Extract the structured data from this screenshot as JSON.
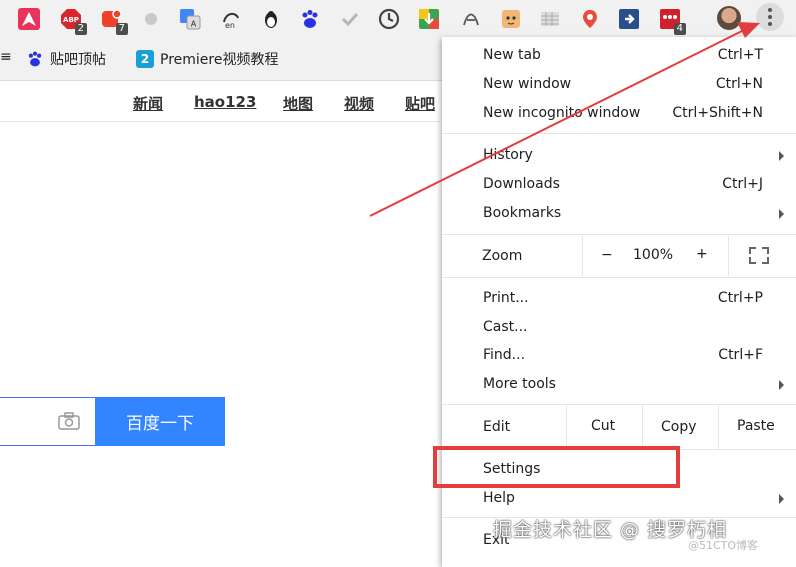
{
  "bookmarks": {
    "partial": "≡",
    "items": [
      {
        "label": "贴吧顶帖"
      },
      {
        "label": "Premiere视频教程"
      }
    ]
  },
  "extensions": {
    "abp_badge": "2",
    "red_badge": "7",
    "ooo_badge": "4"
  },
  "page_nav": [
    "新闻",
    "hao123",
    "地图",
    "视频",
    "贴吧"
  ],
  "search": {
    "button_label": "百度一下"
  },
  "menu": {
    "new_tab": "New tab",
    "new_tab_sc": "Ctrl+T",
    "new_window": "New window",
    "new_window_sc": "Ctrl+N",
    "incognito": "New incognito window",
    "incognito_sc": "Ctrl+Shift+N",
    "history": "History",
    "downloads": "Downloads",
    "downloads_sc": "Ctrl+J",
    "bookmarks": "Bookmarks",
    "zoom": "Zoom",
    "zoom_minus": "−",
    "zoom_value": "100%",
    "zoom_plus": "+",
    "print": "Print...",
    "print_sc": "Ctrl+P",
    "cast": "Cast...",
    "find": "Find...",
    "find_sc": "Ctrl+F",
    "more_tools": "More tools",
    "edit": "Edit",
    "cut": "Cut",
    "copy": "Copy",
    "paste": "Paste",
    "settings": "Settings",
    "help": "Help",
    "exit": "Exit"
  },
  "watermark": {
    "text": "掘金技术社区 @ 搜罗朽相",
    "small": "@51CTO博客"
  },
  "colors": {
    "annotation_red": "#e33e3e",
    "search_button": "#3385ff"
  }
}
